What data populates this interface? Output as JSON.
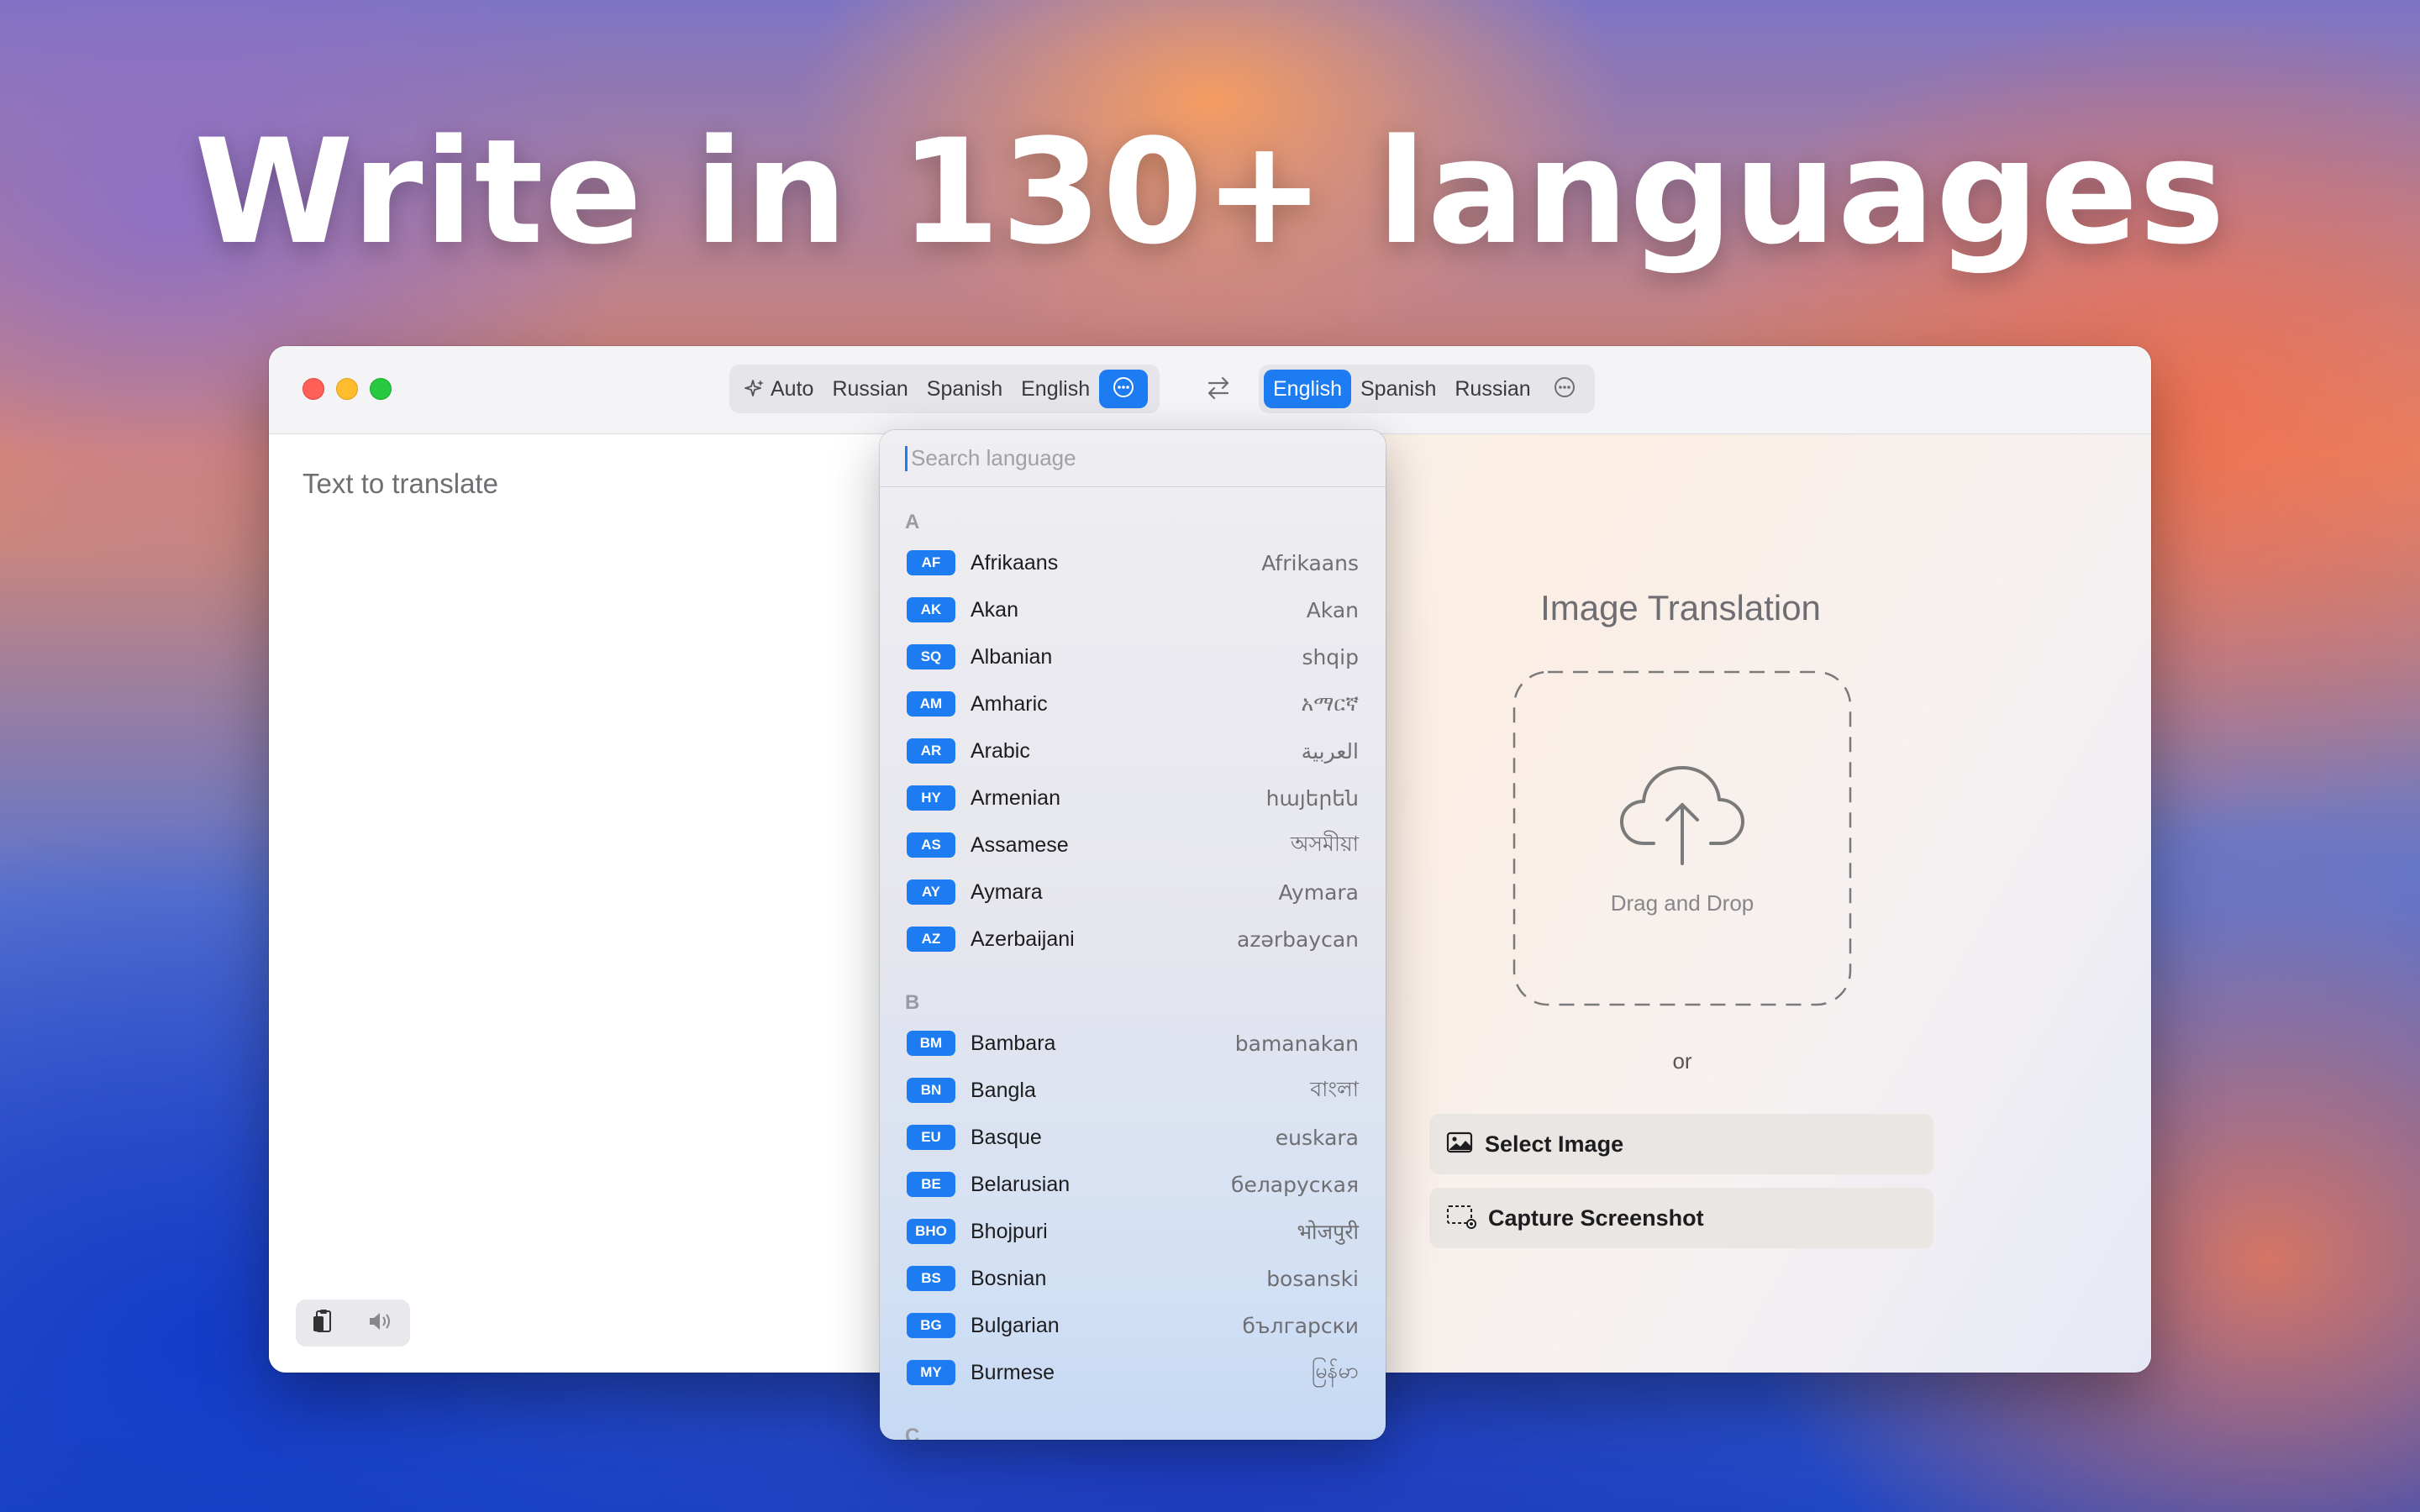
{
  "headline": "Write in 130+ languages",
  "toolbar": {
    "source_langs": [
      "Auto",
      "Russian",
      "Spanish",
      "English"
    ],
    "target_langs": [
      "English",
      "Spanish",
      "Russian"
    ],
    "accent": "#1e7cf2"
  },
  "editor": {
    "placeholder": "Text to translate"
  },
  "image_panel": {
    "title": "Image Translation",
    "drop_label": "Drag and Drop",
    "or_label": "or",
    "select_image": "Select Image",
    "capture_screenshot": "Capture Screenshot"
  },
  "language_menu": {
    "search_placeholder": "Search language",
    "sections": [
      {
        "letter": "A",
        "items": [
          {
            "code": "AF",
            "name": "Afrikaans",
            "native": "Afrikaans"
          },
          {
            "code": "AK",
            "name": "Akan",
            "native": "Akan"
          },
          {
            "code": "SQ",
            "name": "Albanian",
            "native": "shqip"
          },
          {
            "code": "AM",
            "name": "Amharic",
            "native": "አማርኛ"
          },
          {
            "code": "AR",
            "name": "Arabic",
            "native": "العربية"
          },
          {
            "code": "HY",
            "name": "Armenian",
            "native": "հայերեն"
          },
          {
            "code": "AS",
            "name": "Assamese",
            "native": "অসমীয়া"
          },
          {
            "code": "AY",
            "name": "Aymara",
            "native": "Aymara"
          },
          {
            "code": "AZ",
            "name": "Azerbaijani",
            "native": "azərbaycan"
          }
        ]
      },
      {
        "letter": "B",
        "items": [
          {
            "code": "BM",
            "name": "Bambara",
            "native": "bamanakan"
          },
          {
            "code": "BN",
            "name": "Bangla",
            "native": "বাংলা"
          },
          {
            "code": "EU",
            "name": "Basque",
            "native": "euskara"
          },
          {
            "code": "BE",
            "name": "Belarusian",
            "native": "беларуская"
          },
          {
            "code": "BHO",
            "name": "Bhojpuri",
            "native": "भोजपुरी"
          },
          {
            "code": "BS",
            "name": "Bosnian",
            "native": "bosanski"
          },
          {
            "code": "BG",
            "name": "Bulgarian",
            "native": "български"
          },
          {
            "code": "MY",
            "name": "Burmese",
            "native": "မြန်မာ"
          }
        ]
      },
      {
        "letter": "C",
        "items": []
      }
    ]
  }
}
